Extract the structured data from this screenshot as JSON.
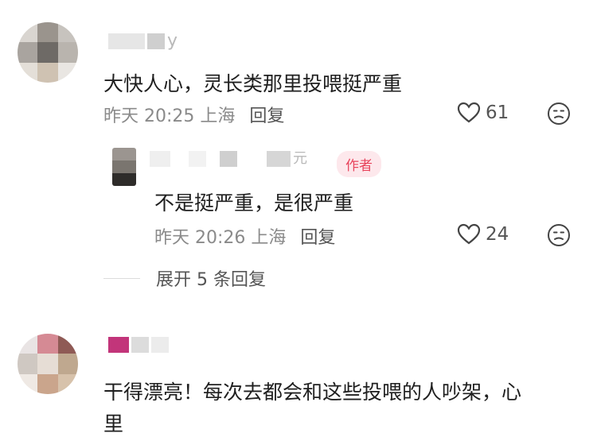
{
  "comments": [
    {
      "username_suffix": "y",
      "text": "大快人心，灵长类那里投喂挺严重",
      "meta": "昨天 20:25 上海",
      "reply_label": "回复",
      "likes": "61",
      "replies": [
        {
          "username_suffix": "元",
          "author_tag": "作者",
          "text": "不是挺严重，是很严重",
          "meta": "昨天 20:26 上海",
          "reply_label": "回复",
          "likes": "24"
        }
      ],
      "expand_label": "展开 5 条回复"
    },
    {
      "text": "干得漂亮！每次去都会和这些投喂的人吵架，心",
      "text_overflow": "里"
    }
  ],
  "colors": {
    "author_tag_bg": "#fde8ec",
    "author_tag_text": "#e8455d",
    "meta_text": "#8a8a8a"
  },
  "icons": [
    "heart-outline-icon",
    "dislike-face-icon"
  ]
}
